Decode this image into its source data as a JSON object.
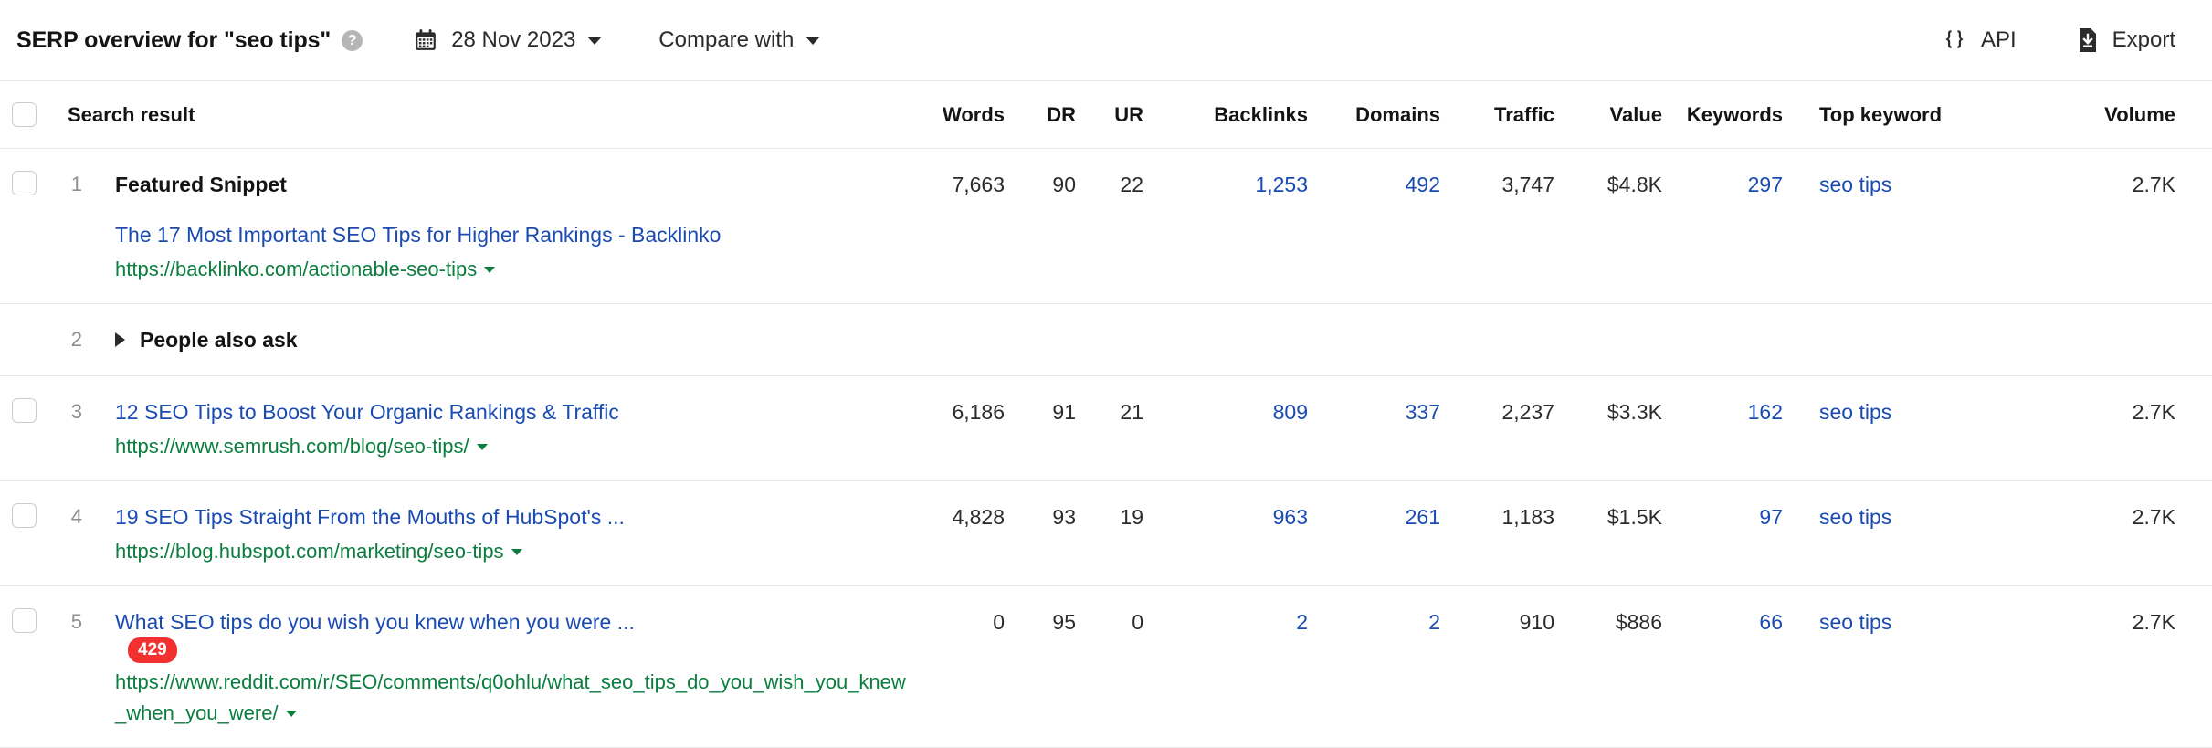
{
  "toolbar": {
    "title": "SERP overview for \"seo tips\"",
    "help_icon": "question-mark-icon",
    "calendar_icon": "calendar-icon",
    "date": "28 Nov 2023",
    "compare_label": "Compare with",
    "api_label": "API",
    "api_icon": "curly-braces-icon",
    "export_label": "Export",
    "export_icon": "download-file-icon"
  },
  "table": {
    "headers": {
      "search_result": "Search result",
      "words": "Words",
      "dr": "DR",
      "ur": "UR",
      "backlinks": "Backlinks",
      "domains": "Domains",
      "traffic": "Traffic",
      "value": "Value",
      "keywords": "Keywords",
      "top_keyword": "Top keyword",
      "volume": "Volume"
    },
    "rows": [
      {
        "rank": "1",
        "type": "featured-snippet",
        "snippet_label": "Featured Snippet",
        "title": "The 17 Most Important SEO Tips for Higher Rankings - Backlinko",
        "url": "https://backlinko.com/actionable-seo-tips",
        "badge": null,
        "words": "7,663",
        "dr": "90",
        "ur": "22",
        "backlinks": "1,253",
        "domains": "492",
        "traffic": "3,747",
        "value": "$4.8K",
        "keywords": "297",
        "top_keyword": "seo tips",
        "volume": "2.7K"
      },
      {
        "rank": "2",
        "type": "people-also-ask",
        "snippet_label": "People also ask",
        "title": null,
        "url": null,
        "badge": null,
        "words": "",
        "dr": "",
        "ur": "",
        "backlinks": "",
        "domains": "",
        "traffic": "",
        "value": "",
        "keywords": "",
        "top_keyword": "",
        "volume": ""
      },
      {
        "rank": "3",
        "type": "organic",
        "snippet_label": null,
        "title": "12 SEO Tips to Boost Your Organic Rankings & Traffic",
        "url": "https://www.semrush.com/blog/seo-tips/",
        "badge": null,
        "words": "6,186",
        "dr": "91",
        "ur": "21",
        "backlinks": "809",
        "domains": "337",
        "traffic": "2,237",
        "value": "$3.3K",
        "keywords": "162",
        "top_keyword": "seo tips",
        "volume": "2.7K"
      },
      {
        "rank": "4",
        "type": "organic",
        "snippet_label": null,
        "title": "19 SEO Tips Straight From the Mouths of HubSpot's ...",
        "url": "https://blog.hubspot.com/marketing/seo-tips",
        "badge": null,
        "words": "4,828",
        "dr": "93",
        "ur": "19",
        "backlinks": "963",
        "domains": "261",
        "traffic": "1,183",
        "value": "$1.5K",
        "keywords": "97",
        "top_keyword": "seo tips",
        "volume": "2.7K"
      },
      {
        "rank": "5",
        "type": "organic",
        "snippet_label": null,
        "title": "What SEO tips do you wish you knew when you were ...",
        "url": "https://www.reddit.com/r/SEO/comments/q0ohlu/what_seo_tips_do_you_wish_you_knew_when_you_were/",
        "badge": "429",
        "words": "0",
        "dr": "95",
        "ur": "0",
        "backlinks": "2",
        "domains": "2",
        "traffic": "910",
        "value": "$886",
        "keywords": "66",
        "top_keyword": "seo tips",
        "volume": "2.7K"
      }
    ]
  },
  "colors": {
    "link": "#1a4bb3",
    "url": "#0b7d3e",
    "badge": "#f23030",
    "border": "#e6e8ea"
  }
}
